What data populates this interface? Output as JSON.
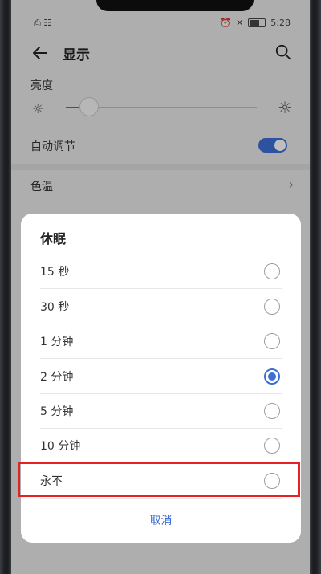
{
  "status_bar": {
    "left_text": "⎙ ☷ ",
    "time": "5:28"
  },
  "app_bar": {
    "title": "显示",
    "back_icon": "back-arrow-icon",
    "search_icon": "search-icon"
  },
  "brightness": {
    "label": "亮度",
    "level": 0.12
  },
  "auto_adjust": {
    "label": "自动调节",
    "on": true
  },
  "color_temp": {
    "label": "色温"
  },
  "dialog": {
    "title": "休眠",
    "options": [
      {
        "label": "15 秒",
        "selected": false
      },
      {
        "label": "30 秒",
        "selected": false
      },
      {
        "label": "1 分钟",
        "selected": false
      },
      {
        "label": "2 分钟",
        "selected": true
      },
      {
        "label": "5 分钟",
        "selected": false
      },
      {
        "label": "10 分钟",
        "selected": false
      },
      {
        "label": "永不",
        "selected": false
      }
    ],
    "cancel_label": "取消"
  },
  "colors": {
    "accent": "#3d6fd6",
    "highlight": "#e52222"
  }
}
